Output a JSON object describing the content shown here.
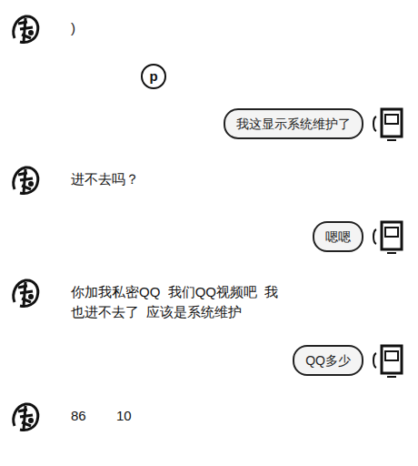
{
  "messages": [
    {
      "side": "left",
      "kind": "text",
      "text": ")"
    },
    {
      "side": "left",
      "kind": "emoji",
      "text": "p"
    },
    {
      "side": "right",
      "kind": "text",
      "text": "我这显示系统维护了"
    },
    {
      "side": "left",
      "kind": "text",
      "text": "进不去吗？"
    },
    {
      "side": "right",
      "kind": "text",
      "text": "嗯嗯"
    },
    {
      "side": "left",
      "kind": "text",
      "text": "你加我私密QQ  我们QQ视频吧  我也进不去了  应该是系统维护"
    },
    {
      "side": "right",
      "kind": "text",
      "text": "QQ多少"
    },
    {
      "side": "left",
      "kind": "text",
      "text": "86        10"
    }
  ]
}
